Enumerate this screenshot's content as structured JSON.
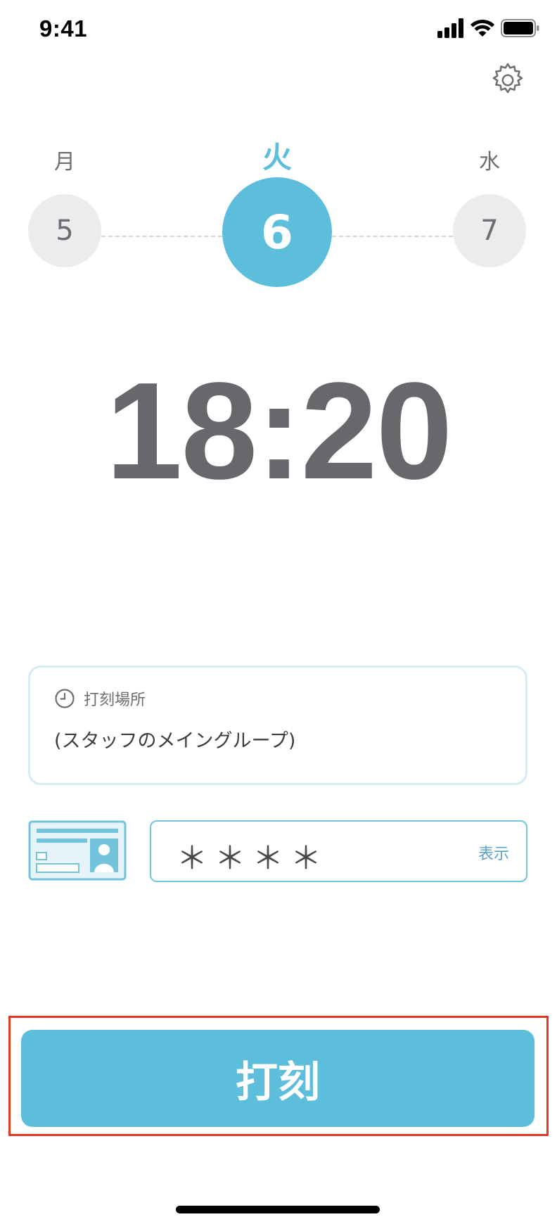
{
  "status_bar": {
    "time": "9:41"
  },
  "days": {
    "prev": {
      "weekday": "月",
      "date": "5"
    },
    "current": {
      "weekday": "火",
      "date": "6"
    },
    "next": {
      "weekday": "水",
      "date": "7"
    }
  },
  "clock": {
    "time": "18:20"
  },
  "location": {
    "label": "打刻場所",
    "value": "(スタッフのメイングループ)"
  },
  "passcode": {
    "masked_value": "＊＊＊＊",
    "show_label": "表示"
  },
  "punch_button": {
    "label": "打刻"
  },
  "colors": {
    "accent": "#5dbedc",
    "highlight": "#e03a22",
    "clock_text": "#68686c"
  }
}
